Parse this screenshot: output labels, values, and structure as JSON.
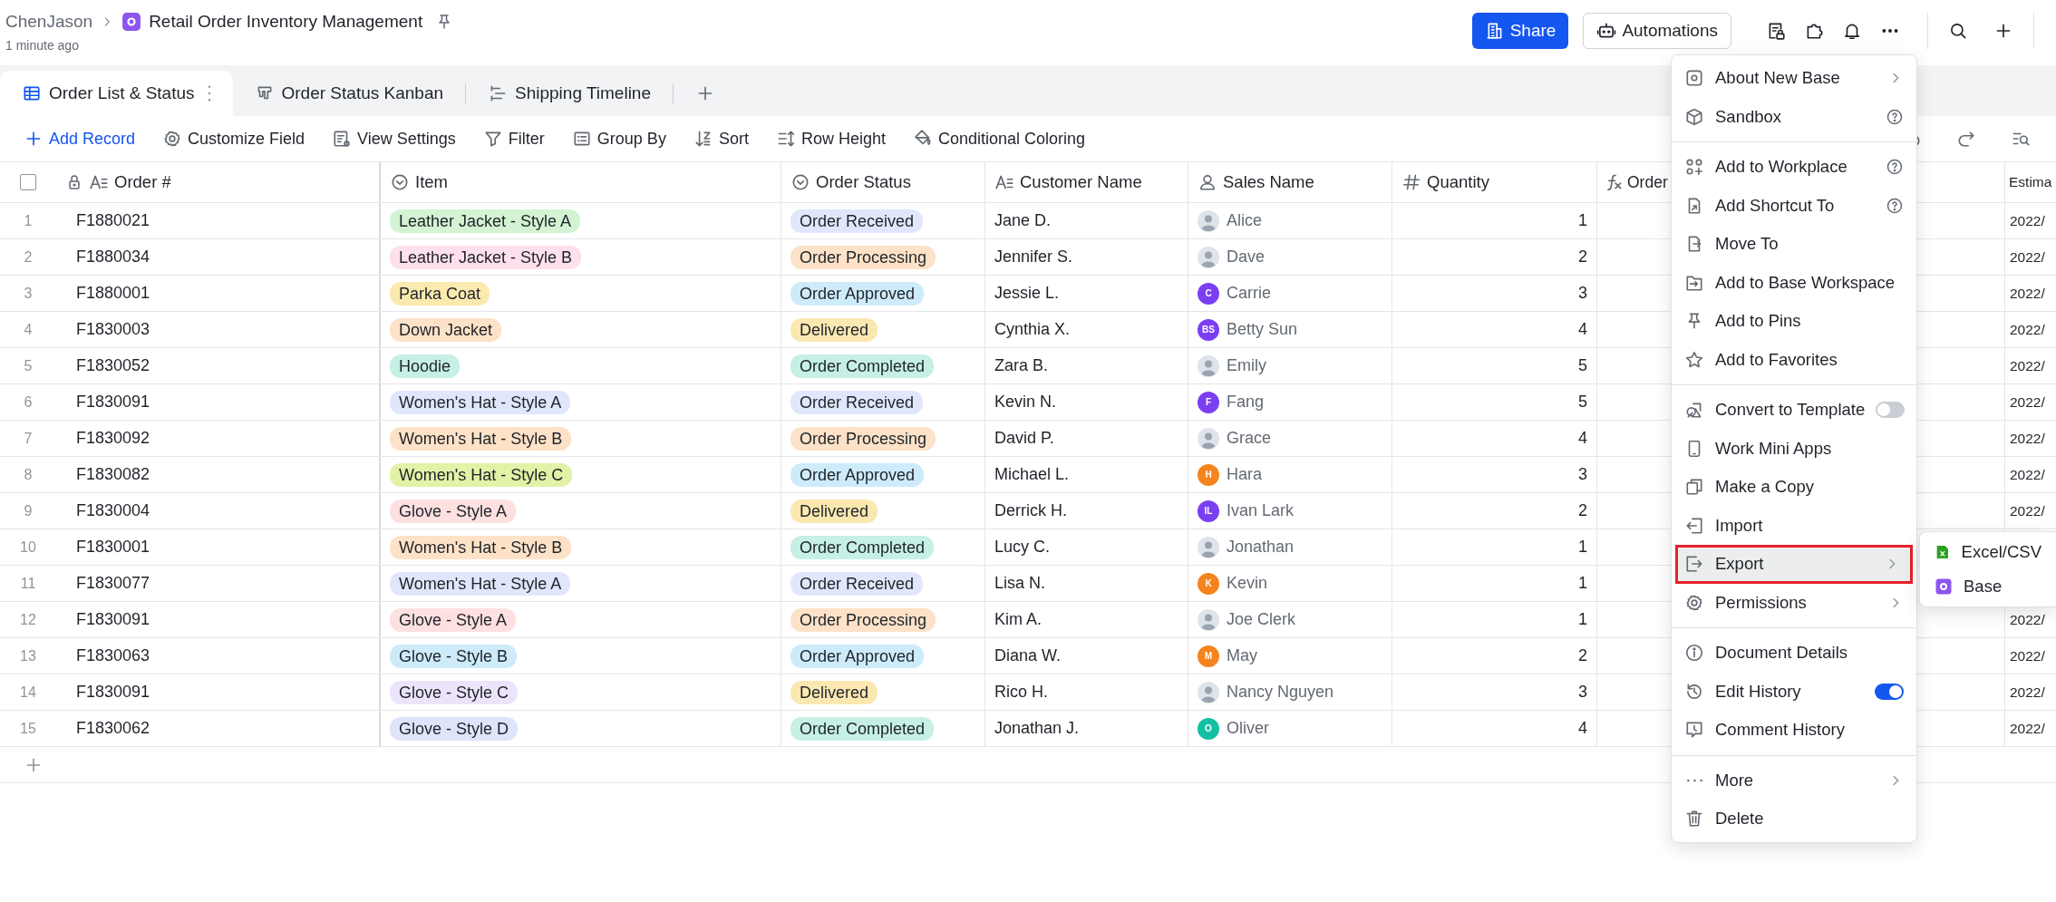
{
  "breadcrumb": {
    "owner": "ChenJason",
    "title": "Retail Order Inventory Management",
    "updated": "1 minute ago"
  },
  "header_buttons": [
    {
      "label": "Share",
      "kind": "primary"
    },
    {
      "label": "Automations",
      "kind": "outline"
    }
  ],
  "tabs": [
    {
      "label": "Order List & Status",
      "selected": true
    },
    {
      "label": "Order Status Kanban",
      "selected": false
    },
    {
      "label": "Shipping Timeline",
      "selected": false
    }
  ],
  "toolbar": [
    {
      "label": "Add Record",
      "kind": "primary"
    },
    {
      "label": "Customize Field",
      "kind": "plain"
    },
    {
      "label": "View Settings",
      "kind": "plain"
    },
    {
      "label": "Filter",
      "kind": "plain"
    },
    {
      "label": "Group By",
      "kind": "plain"
    },
    {
      "label": "Sort",
      "kind": "plain"
    },
    {
      "label": "Row Height",
      "kind": "plain"
    },
    {
      "label": "Conditional Coloring",
      "kind": "plain"
    }
  ],
  "table": {
    "select_all": {
      "checked": false
    },
    "columns": [
      {
        "label": "Order #",
        "kind": "primary"
      },
      {
        "label": "Item",
        "kind": "select"
      },
      {
        "label": "Order Status",
        "kind": "select"
      },
      {
        "label": "Customer Name",
        "kind": "text"
      },
      {
        "label": "Sales Name",
        "kind": "user"
      },
      {
        "label": "Quantity",
        "kind": "number"
      },
      {
        "label": "Order",
        "kind": "formula"
      },
      {
        "label": "Estima",
        "kind": "date"
      }
    ],
    "rows": [
      {
        "num": "1",
        "order": "F1880021",
        "item": {
          "text": "Leather Jacket - Style A",
          "color": "#d3f3d3"
        },
        "status": {
          "text": "Order Received",
          "color": "#e0e6fb"
        },
        "customer": "Jane D.",
        "sales": {
          "name": "Alice",
          "kind": "photo"
        },
        "quantity": "1",
        "estimate": "2022/"
      },
      {
        "num": "2",
        "order": "F1880034",
        "item": {
          "text": "Leather Jacket - Style B",
          "color": "#fde0ec"
        },
        "status": {
          "text": "Order Processing",
          "color": "#fde2c8"
        },
        "customer": "Jennifer S.",
        "sales": {
          "name": "Dave",
          "kind": "photo"
        },
        "quantity": "2",
        "estimate": "2022/"
      },
      {
        "num": "3",
        "order": "F1880001",
        "item": {
          "text": "Parka Coat",
          "color": "#fbeab0"
        },
        "status": {
          "text": "Order Approved",
          "color": "#cdebfa"
        },
        "customer": "Jessie L.",
        "sales": {
          "name": "Carrie",
          "kind": "initials",
          "initials": "C",
          "color": "#7b3ff2"
        },
        "quantity": "3",
        "estimate": "2022/"
      },
      {
        "num": "4",
        "order": "F1830003",
        "item": {
          "text": "Down Jacket",
          "color": "#fde2c8"
        },
        "status": {
          "text": "Delivered",
          "color": "#fbe8b0"
        },
        "customer": "Cynthia X.",
        "sales": {
          "name": "Betty Sun",
          "kind": "initials",
          "initials": "BS",
          "color": "#7b3ff2"
        },
        "quantity": "4",
        "estimate": "2022/"
      },
      {
        "num": "5",
        "order": "F1830052",
        "item": {
          "text": "Hoodie",
          "color": "#c6efe6"
        },
        "status": {
          "text": "Order Completed",
          "color": "#c6efe6"
        },
        "customer": "Zara B.",
        "sales": {
          "name": "Emily",
          "kind": "photo"
        },
        "quantity": "5",
        "estimate": "2022/"
      },
      {
        "num": "6",
        "order": "F1830091",
        "item": {
          "text": "Women's Hat - Style A",
          "color": "#e0e6fb"
        },
        "status": {
          "text": "Order Received",
          "color": "#e0e6fb"
        },
        "customer": "Kevin N.",
        "sales": {
          "name": "Fang",
          "kind": "initials",
          "initials": "F",
          "color": "#7b3ff2"
        },
        "quantity": "5",
        "estimate": "2022/"
      },
      {
        "num": "7",
        "order": "F1830092",
        "item": {
          "text": "Women's Hat - Style B",
          "color": "#fde2c8"
        },
        "status": {
          "text": "Order Processing",
          "color": "#fde2c8"
        },
        "customer": "David P.",
        "sales": {
          "name": "Grace",
          "kind": "photo"
        },
        "quantity": "4",
        "estimate": "2022/"
      },
      {
        "num": "8",
        "order": "F1830082",
        "item": {
          "text": "Women's Hat - Style C",
          "color": "#e2f2a6"
        },
        "status": {
          "text": "Order Approved",
          "color": "#cdebfa"
        },
        "customer": "Michael L.",
        "sales": {
          "name": "Hara",
          "kind": "initials",
          "initials": "H",
          "color": "#f5841f"
        },
        "quantity": "3",
        "estimate": "2022/"
      },
      {
        "num": "9",
        "order": "F1830004",
        "item": {
          "text": "Glove - Style A",
          "color": "#fde0e0"
        },
        "status": {
          "text": "Delivered",
          "color": "#fbe8b0"
        },
        "customer": "Derrick H.",
        "sales": {
          "name": "Ivan Lark",
          "kind": "initials",
          "initials": "IL",
          "color": "#7b3ff2"
        },
        "quantity": "2",
        "estimate": "2022/"
      },
      {
        "num": "10",
        "order": "F1830001",
        "item": {
          "text": "Women's Hat - Style B",
          "color": "#fde2c8"
        },
        "status": {
          "text": "Order Completed",
          "color": "#c6efe6"
        },
        "customer": "Lucy C.",
        "sales": {
          "name": "Jonathan",
          "kind": "photo"
        },
        "quantity": "1"
      },
      {
        "num": "11",
        "order": "F1830077",
        "item": {
          "text": "Women's Hat - Style A",
          "color": "#e0e6fb"
        },
        "status": {
          "text": "Order Received",
          "color": "#e0e6fb"
        },
        "customer": "Lisa N.",
        "sales": {
          "name": "Kevin",
          "kind": "initials",
          "initials": "K",
          "color": "#f5841f"
        },
        "quantity": "1"
      },
      {
        "num": "12",
        "order": "F1830091",
        "item": {
          "text": "Glove - Style A",
          "color": "#fde0e0"
        },
        "status": {
          "text": "Order Processing",
          "color": "#fde2c8"
        },
        "customer": "Kim A.",
        "sales": {
          "name": "Joe Clerk",
          "kind": "photo"
        },
        "quantity": "1",
        "estimate": "2022/"
      },
      {
        "num": "13",
        "order": "F1830063",
        "item": {
          "text": "Glove - Style B",
          "color": "#cdebfa"
        },
        "status": {
          "text": "Order Approved",
          "color": "#cdebfa"
        },
        "customer": "Diana W.",
        "sales": {
          "name": "May",
          "kind": "initials",
          "initials": "M",
          "color": "#f5841f"
        },
        "quantity": "2",
        "estimate": "2022/"
      },
      {
        "num": "14",
        "order": "F1830091",
        "item": {
          "text": "Glove - Style C",
          "color": "#ece4fb"
        },
        "status": {
          "text": "Delivered",
          "color": "#fbe8b0"
        },
        "customer": "Rico H.",
        "sales": {
          "name": "Nancy Nguyen",
          "kind": "photo"
        },
        "quantity": "3",
        "estimate": "2022/"
      },
      {
        "num": "15",
        "order": "F1830062",
        "item": {
          "text": "Glove - Style D",
          "color": "#dfe4fb"
        },
        "status": {
          "text": "Order Completed",
          "color": "#c6efe6"
        },
        "customer": "Jonathan J.",
        "sales": {
          "name": "Oliver",
          "kind": "initials",
          "initials": "O",
          "color": "#14c0a4"
        },
        "quantity": "4",
        "estimate": "2022/"
      }
    ]
  },
  "menu": {
    "groups": [
      [
        {
          "label": "About New Base",
          "kind": "submenu"
        },
        {
          "label": "Sandbox",
          "kind": "help"
        }
      ],
      [
        {
          "label": "Add to Workplace",
          "kind": "help"
        },
        {
          "label": "Add Shortcut To",
          "kind": "help"
        },
        {
          "label": "Move To",
          "kind": "plain"
        },
        {
          "label": "Add to Base Workspace",
          "kind": "plain"
        },
        {
          "label": "Add to Pins",
          "kind": "plain"
        },
        {
          "label": "Add to Favorites",
          "kind": "plain"
        }
      ],
      [
        {
          "label": "Convert to Template",
          "kind": "toggle",
          "on": false
        },
        {
          "label": "Work Mini Apps",
          "kind": "plain"
        },
        {
          "label": "Make a Copy",
          "kind": "plain"
        },
        {
          "label": "Import",
          "kind": "plain"
        },
        {
          "label": "Export",
          "kind": "submenu",
          "highlighted": true
        },
        {
          "label": "Permissions",
          "kind": "submenu"
        }
      ],
      [
        {
          "label": "Document Details",
          "kind": "plain"
        },
        {
          "label": "Edit History",
          "kind": "toggle",
          "on": true
        },
        {
          "label": "Comment History",
          "kind": "plain"
        }
      ],
      [
        {
          "label": "More",
          "kind": "submenu"
        },
        {
          "label": "Delete",
          "kind": "plain"
        }
      ]
    ]
  },
  "submenu": {
    "items": [
      {
        "label": "Excel/CSV",
        "kind": "excel"
      },
      {
        "label": "Base",
        "kind": "base"
      }
    ]
  }
}
